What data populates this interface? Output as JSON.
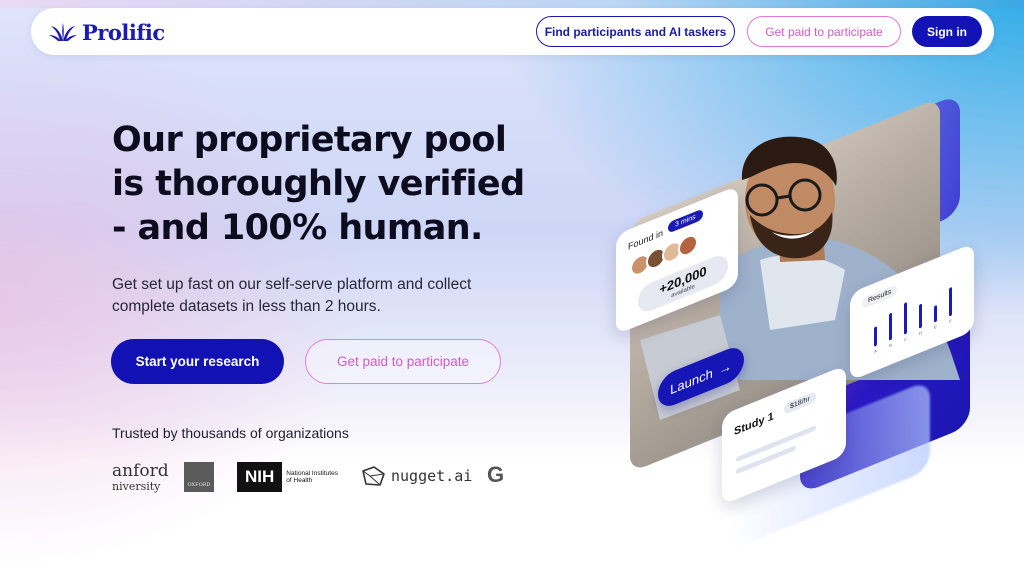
{
  "brand": {
    "name": "Prolific",
    "color": "#1b1bb0"
  },
  "nav": {
    "find_label": "Find participants and AI taskers",
    "paid_label": "Get paid to participate",
    "signin_label": "Sign in"
  },
  "hero": {
    "headline_lines": [
      "Our proprietary pool",
      "is thoroughly verified",
      "- and 100% human."
    ],
    "subtext": "Get set up fast on our self-serve platform and collect complete datasets in less than 2 hours.",
    "cta_primary": "Start your research",
    "cta_secondary": "Get paid to participate",
    "trusted": "Trusted by thousands of organizations"
  },
  "logos": {
    "stanford_line1": "anford",
    "stanford_line2": "niversity",
    "oxford": "OXFORD",
    "nih_mark": "NIH",
    "nih_name": "National Institutes of Health",
    "nugget": "nugget.ai",
    "google_partial": "G"
  },
  "visual": {
    "found_label": "Found in",
    "found_time": "3 mins",
    "count": "+20,000",
    "count_sub": "available",
    "results_label": "Results",
    "results_axis": [
      "A",
      "B",
      "C",
      "D",
      "E",
      "F"
    ],
    "results_bars": [
      0.55,
      0.8,
      0.95,
      0.7,
      0.45,
      0.85
    ],
    "launch_label": "Launch",
    "study_title": "Study 1",
    "study_rate": "$18/hr"
  },
  "colors": {
    "primary": "#1313b5",
    "accent_pink": "#d35bc9"
  }
}
